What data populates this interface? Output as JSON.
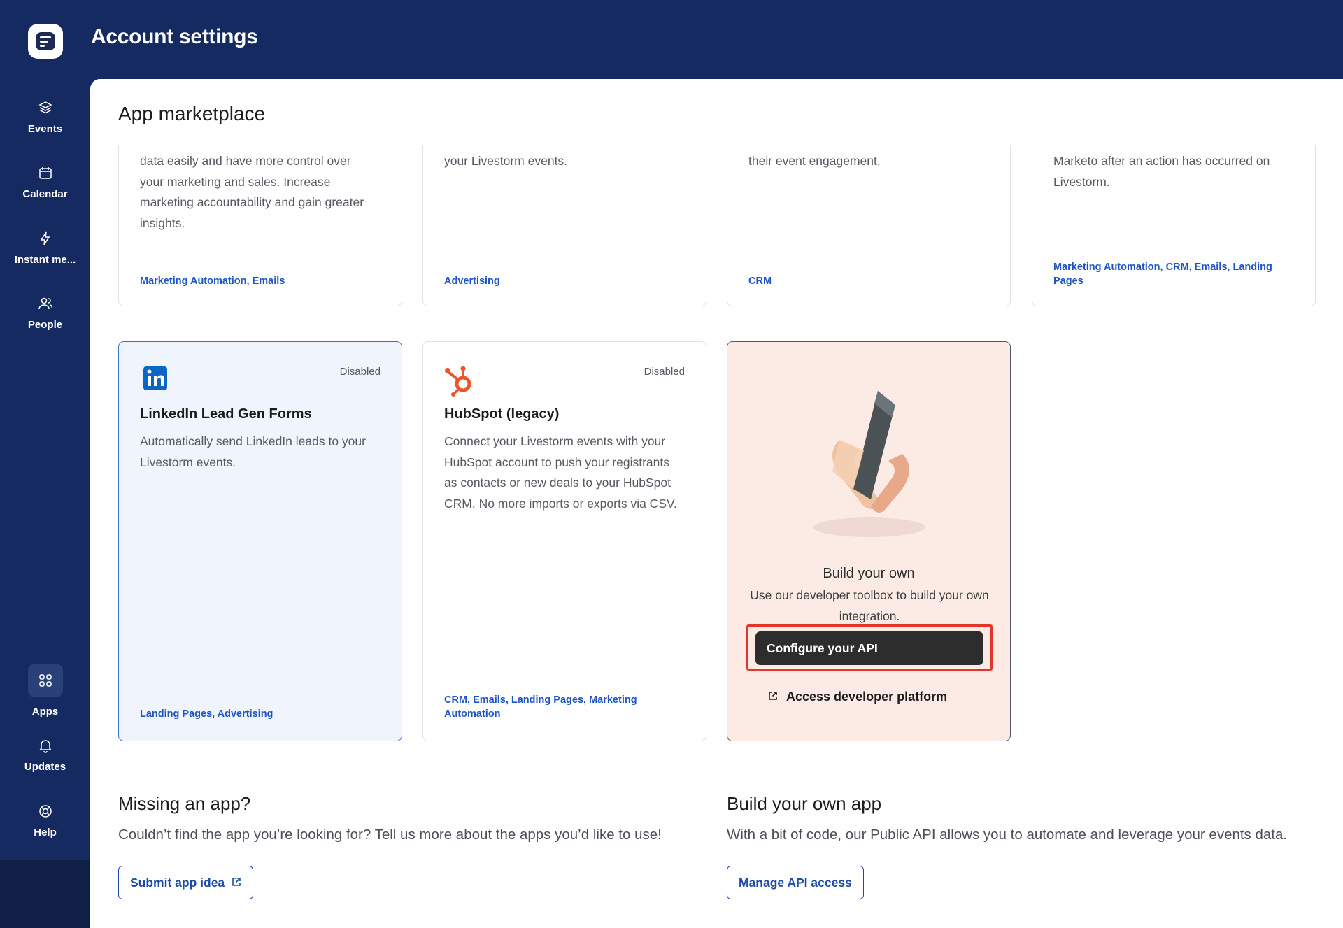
{
  "header": {
    "title": "Account settings"
  },
  "sidebar": {
    "items": [
      {
        "label": "Events",
        "icon": "layers-icon"
      },
      {
        "label": "Calendar",
        "icon": "calendar-icon"
      },
      {
        "label": "Instant me...",
        "icon": "lightning-icon"
      },
      {
        "label": "People",
        "icon": "people-icon"
      },
      {
        "label": "Apps",
        "icon": "grid-icon",
        "active": true
      },
      {
        "label": "Updates",
        "icon": "bell-icon"
      },
      {
        "label": "Help",
        "icon": "lifebuoy-icon"
      }
    ]
  },
  "main": {
    "title": "App marketplace",
    "top_cards": [
      {
        "desc": [
          "data easily and have more control over",
          "your marketing and sales. Increase",
          "marketing accountability and gain greater",
          "insights."
        ],
        "tags": [
          "Marketing Automation, Emails"
        ]
      },
      {
        "desc": [
          "your Livestorm events."
        ],
        "tags": [
          "Advertising"
        ]
      },
      {
        "desc": [
          "their event engagement."
        ],
        "tags": [
          "CRM"
        ]
      },
      {
        "desc": [
          "Marketo after an action has occurred on",
          "Livestorm."
        ],
        "tags": [
          "Marketing Automation, CRM, Emails, Landing",
          "Pages"
        ]
      }
    ],
    "apps": [
      {
        "name": "LinkedIn Lead Gen Forms",
        "status": "Disabled",
        "desc": [
          "Automatically send LinkedIn leads to your",
          "Livestorm events."
        ],
        "tags": [
          "Landing Pages, Advertising"
        ],
        "icon": "linkedin-icon"
      },
      {
        "name": "HubSpot (legacy)",
        "status": "Disabled",
        "desc": [
          "Connect your Livestorm events with your",
          "HubSpot account to push your registrants",
          "as contacts or new deals to your HubSpot",
          "CRM. No more imports or exports via CSV."
        ],
        "tags": [
          "CRM, Emails, Landing Pages, Marketing",
          "Automation"
        ],
        "icon": "hubspot-icon"
      }
    ],
    "build_card": {
      "title": "Build your own",
      "desc": "Use our developer toolbox to build your own integration.",
      "button": "Configure your API",
      "link": "Access developer platform"
    },
    "missing": {
      "title": "Missing an app?",
      "desc": "Couldn’t find the app you’re looking for? Tell us more about the apps you’d like to use!",
      "button": "Submit app idea"
    },
    "build_app": {
      "title": "Build your own app",
      "desc": "With a bit of code, our Public API allows you to automate and leverage your events data.",
      "button": "Manage API access"
    }
  },
  "colors": {
    "sidebar": "#142a61",
    "accent": "#1e55c4",
    "highlight": "#e5352a",
    "build_bg": "#fcebe4"
  }
}
